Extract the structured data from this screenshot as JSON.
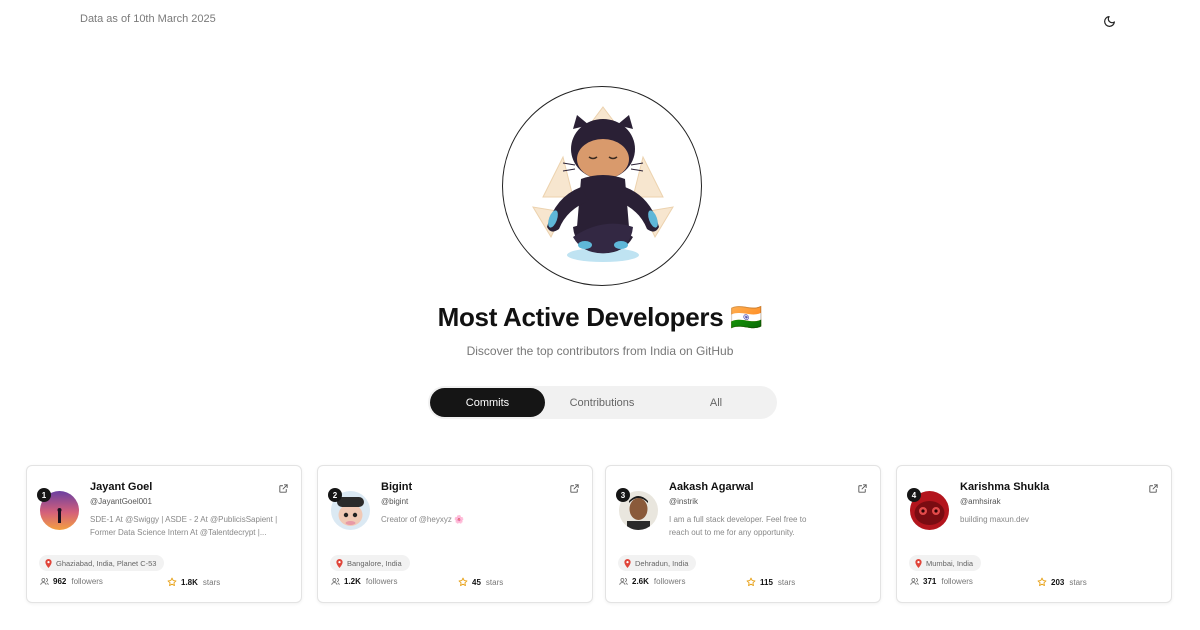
{
  "header": {
    "date_text": "Data as of 10th March 2025"
  },
  "page": {
    "title": "Most Active Developers 🇮🇳",
    "subtitle": "Discover the top contributors from India on GitHub"
  },
  "tabs": [
    {
      "label": "Commits",
      "active": true
    },
    {
      "label": "Contributions",
      "active": false
    },
    {
      "label": "All",
      "active": false
    }
  ],
  "developers": [
    {
      "rank": "1",
      "name": "Jayant Goel",
      "handle": "@JayantGoel001",
      "bio": "SDE-1 At @Swiggy | ASDE - 2 At @PublicisSapient | Former Data Science Intern At @Talentdecrypt |...",
      "location": "Ghaziabad, India, Planet C-53",
      "followers": "962",
      "followers_label": "followers",
      "stars": "1.8K",
      "stars_label": "stars"
    },
    {
      "rank": "2",
      "name": "Bigint",
      "handle": "@bigint",
      "bio": "Creator of @heyxyz 🌸",
      "location": "Bangalore, India",
      "followers": "1.2K",
      "followers_label": "followers",
      "stars": "45",
      "stars_label": "stars"
    },
    {
      "rank": "3",
      "name": "Aakash Agarwal",
      "handle": "@instrik",
      "bio": "I am a full stack developer. Feel free to reach out to me for any opportunity.",
      "location": "Dehradun, India",
      "followers": "2.6K",
      "followers_label": "followers",
      "stars": "115",
      "stars_label": "stars"
    },
    {
      "rank": "4",
      "name": "Karishma Shukla",
      "handle": "@amhsirak",
      "bio": "building maxun.dev",
      "location": "Mumbai, India",
      "followers": "371",
      "followers_label": "followers",
      "stars": "203",
      "stars_label": "stars"
    }
  ],
  "icons": {
    "theme": "moon-icon",
    "external": "external-link-icon",
    "location": "map-pin-icon",
    "followers": "users-icon",
    "stars": "star-icon"
  },
  "colors": {
    "accent_dark": "#151515",
    "star": "#e8a21a",
    "pin": "#e0453a"
  }
}
